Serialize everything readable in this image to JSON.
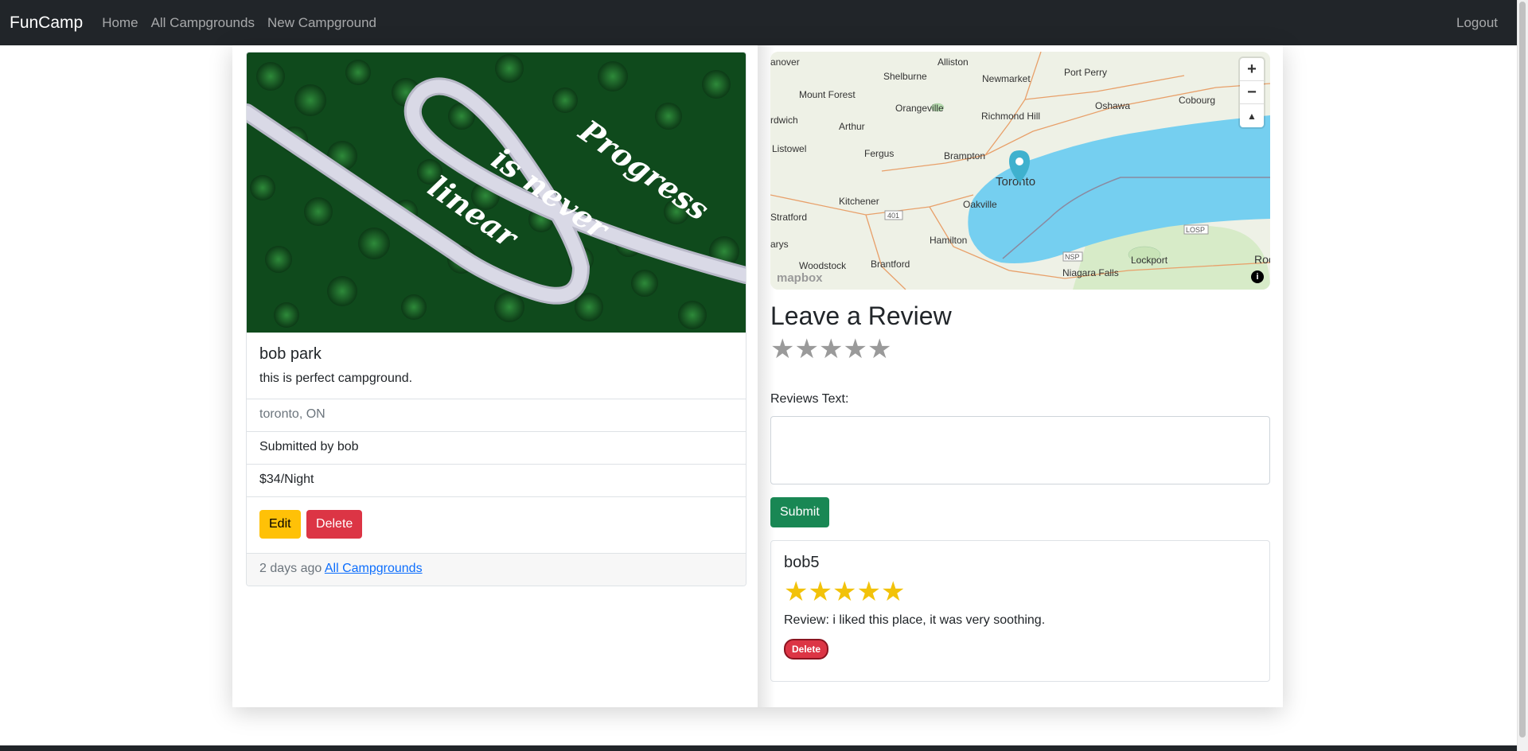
{
  "navbar": {
    "brand": "FunCamp",
    "links": [
      "Home",
      "All Campgrounds",
      "New Campground"
    ],
    "logout": "Logout"
  },
  "campground": {
    "image_text": "Progress is never linear",
    "title": "bob park",
    "description": "this is perfect campground.",
    "location": "toronto, ON",
    "submitted_by": "Submitted by bob",
    "price": "$34/Night",
    "edit_label": "Edit",
    "delete_label": "Delete",
    "posted": "2 days ago",
    "back_link": "All Campgrounds"
  },
  "map": {
    "labels": [
      "anover",
      "Alliston",
      "Shelburne",
      "Newmarket",
      "Port Perry",
      "Mount Forest",
      "Orangeville",
      "Richmond Hill",
      "Oshawa",
      "Cobourg",
      "rdwich",
      "Arthur",
      "Listowel",
      "Fergus",
      "Brampton",
      "Toronto",
      "Kitchener",
      "Oakville",
      "Stratford",
      "Hamilton",
      "arys",
      "Woodstock",
      "Brantford",
      "Niagara Falls",
      "Lockport",
      "Roc"
    ],
    "highways": [
      "401",
      "QEW",
      "NSP",
      "LOSP"
    ],
    "controls": {
      "zoom_in": "+",
      "zoom_out": "−",
      "reset": "▲"
    },
    "logo": "mapbox",
    "info": "i"
  },
  "review_form": {
    "heading": "Leave a Review",
    "rating": 0,
    "text_label": "Reviews Text:",
    "text_value": "",
    "submit_label": "Submit"
  },
  "reviews": [
    {
      "user": "bob5",
      "rating": 5,
      "text": "Review: i liked this place, it was very soothing.",
      "delete_label": "Delete"
    }
  ],
  "colors": {
    "navbar": "#212529",
    "warning": "#ffc107",
    "danger": "#dc3545",
    "success": "#198754",
    "star_filled": "#f2c20a",
    "star_empty": "#9a9a9a",
    "water": "#75cff0"
  }
}
